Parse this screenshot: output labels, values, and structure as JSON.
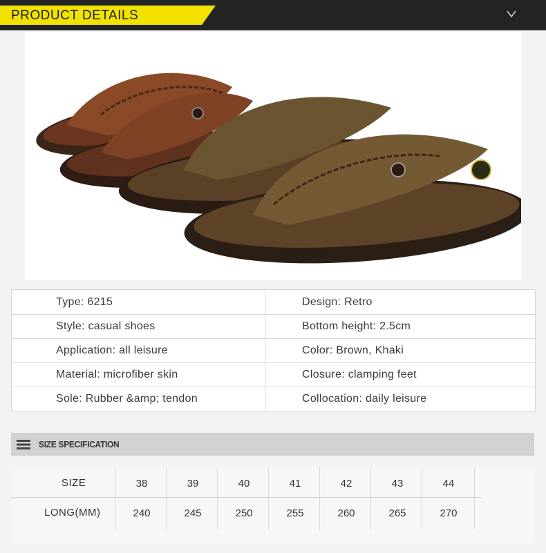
{
  "header": {
    "title": "PRODUCT DETAILS",
    "toggle_icon": "chevron-down-icon"
  },
  "photo": {
    "description_icon": "product-photo",
    "colors": {
      "brown": "#7a3f22",
      "khaki": "#6b5430",
      "sole": "#3b2418"
    }
  },
  "spec": {
    "rows": [
      {
        "left": "Type: 6215",
        "right": "Design: Retro"
      },
      {
        "left": "Style: casual shoes",
        "right": "Bottom height: 2.5cm"
      },
      {
        "left": "Application: all leisure",
        "right": "Color: Brown, Khaki"
      },
      {
        "left": "Material: microfiber skin",
        "right": "Closure: clamping feet"
      },
      {
        "left": "Sole: Rubber &amp; tendon",
        "right": "Collocation: daily leisure"
      }
    ]
  },
  "size_section": {
    "title": "SIZE SPECIFICATION",
    "icon": "menu-icon"
  },
  "size_table": {
    "size_label": "SIZE",
    "long_label": "LONG(MM)",
    "sizes": [
      "38",
      "39",
      "40",
      "41",
      "42",
      "43",
      "44"
    ],
    "lengths": [
      "240",
      "245",
      "250",
      "255",
      "260",
      "265",
      "270"
    ]
  },
  "colors": {
    "banner_bg": "#232323",
    "banner_accent": "#f3e200"
  }
}
